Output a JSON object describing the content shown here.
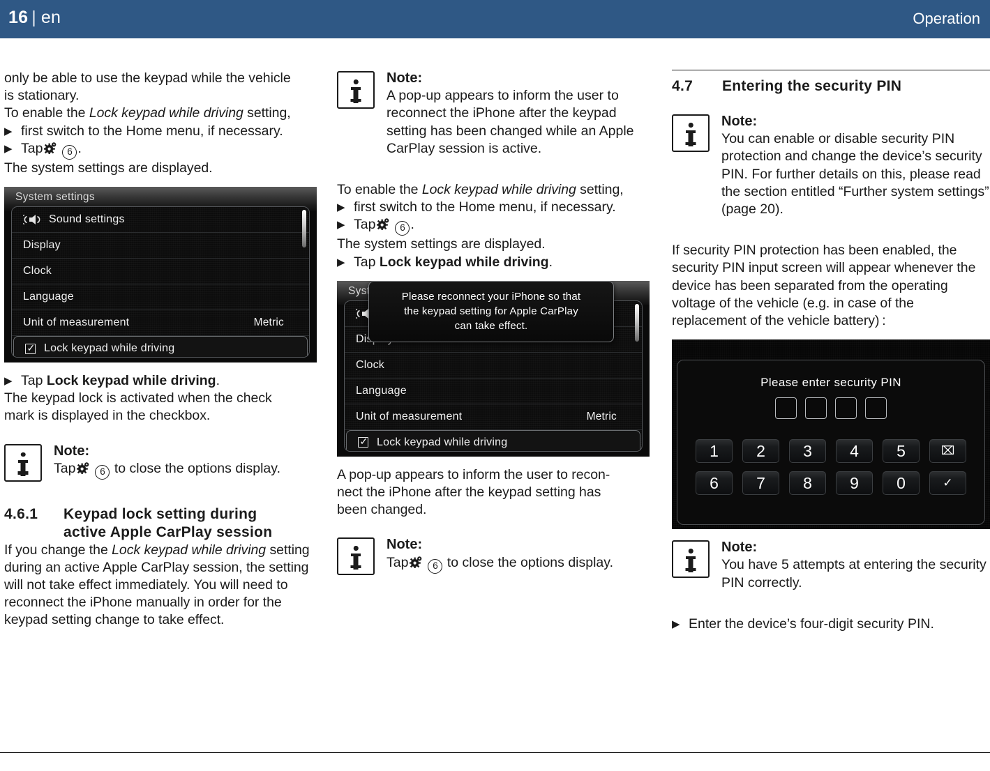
{
  "header": {
    "page_number": "16",
    "separator": "|",
    "language": "en",
    "section": "Operation"
  },
  "column1": {
    "para1_line1": "only be able to use the keypad while the vehicle",
    "para1_line2": "is stationary.",
    "para2_prefix": "To enable the ",
    "para2_italic": "Lock keypad while driving",
    "para2_suffix": " setting,",
    "step1_text": "first switch to the Home menu, if necessary.",
    "step2_prefix": "Tap",
    "step2_callout": "6",
    "step2_suffix": ".",
    "result1": "The system settings are displayed.",
    "screenshot": {
      "title": "System settings",
      "items": [
        {
          "label": "Sound settings",
          "value": "",
          "icon": "speaker-icon",
          "highlight": false
        },
        {
          "label": "Display",
          "value": "",
          "icon": "",
          "highlight": false
        },
        {
          "label": "Clock",
          "value": "",
          "icon": "",
          "highlight": false
        },
        {
          "label": "Language",
          "value": "",
          "icon": "",
          "highlight": false
        },
        {
          "label": "Unit of measurement",
          "value": "Metric",
          "icon": "",
          "highlight": false
        },
        {
          "label": "Lock keypad while driving",
          "value": "",
          "icon": "checkbox-checked-icon",
          "highlight": true
        }
      ]
    },
    "step3_prefix": "Tap ",
    "step3_bold": "Lock keypad while driving",
    "step3_suffix": ".",
    "result2_line1": "The keypad lock is activated when the check",
    "result2_line2": "mark is displayed in the checkbox.",
    "note1": {
      "title": "Note:",
      "text_prefix": "Tap",
      "callout": "6",
      "text_suffix": "to close the options display."
    },
    "heading": {
      "number": "4.6.1",
      "line1": "Keypad lock setting during",
      "line2": "active Apple CarPlay session"
    },
    "para3_prefix": "If you change the ",
    "para3_italic": "Lock keypad while driving",
    "para3_rest": "setting during an active Apple CarPlay session, the setting will not take effect immediately. You will need to reconnect the iPhone manually in order for the keypad setting change to take effect."
  },
  "column2": {
    "note1": {
      "title": "Note:",
      "text": "A pop-up appears to inform the user to reconnect the iPhone after the keypad setting has been changed while an Apple CarPlay session is active."
    },
    "para1_prefix": "To enable the ",
    "para1_italic": "Lock keypad while driving",
    "para1_suffix": " setting,",
    "step1_text": "first switch to the Home menu, if necessary.",
    "step2_prefix": "Tap",
    "step2_callout": "6",
    "step2_suffix": ".",
    "result1": "The system settings are displayed.",
    "step3_prefix": "Tap ",
    "step3_bold": "Lock keypad while driving",
    "step3_suffix": ".",
    "screenshot": {
      "title": "Syst",
      "popup_line1": "Please reconnect your iPhone so that",
      "popup_line2": "the keypad setting for Apple CarPlay",
      "popup_line3": "can take effect.",
      "items": [
        {
          "label": "",
          "value": "",
          "icon": "speaker-icon",
          "highlight": false
        },
        {
          "label": "Display",
          "value": "",
          "icon": "",
          "highlight": false
        },
        {
          "label": "Clock",
          "value": "",
          "icon": "",
          "highlight": false
        },
        {
          "label": "Language",
          "value": "",
          "icon": "",
          "highlight": false
        },
        {
          "label": "Unit of measurement",
          "value": "Metric",
          "icon": "",
          "highlight": false
        },
        {
          "label": "Lock keypad while driving",
          "value": "",
          "icon": "checkbox-checked-icon",
          "highlight": true
        }
      ]
    },
    "result2_line1": "A pop-up appears to inform the user to recon-",
    "result2_line2": "nect the iPhone after the keypad setting has",
    "result2_line3": "been changed.",
    "note2": {
      "title": "Note:",
      "text_prefix": "Tap",
      "callout": "6",
      "text_suffix": "to close the options display."
    }
  },
  "column3": {
    "heading": {
      "number": "4.7",
      "title": "Entering the security PIN"
    },
    "note1": {
      "title": "Note:",
      "text": "You can enable or disable security PIN protection and change the device’s security PIN. For further details on this, please read the section entitled “Further system settings” (page 20)."
    },
    "para1": "If security PIN protection has been enabled, the security PIN input screen will appear whenever the device has been separated from the operating voltage of the vehicle (e.g. in case of the replacement of the vehicle battery) :",
    "pin_screen": {
      "prompt": "Please enter security PIN",
      "digit_count": 4,
      "keys_row1": [
        "1",
        "2",
        "3",
        "4",
        "5",
        "⌧"
      ],
      "keys_row2": [
        "6",
        "7",
        "8",
        "9",
        "0",
        "✓"
      ]
    },
    "note2": {
      "title": "Note:",
      "text": "You have 5 attempts at entering the security PIN correctly."
    },
    "step1_text": "Enter the device’s four-digit security PIN."
  },
  "colors": {
    "header_blue": "#2f5885",
    "text_black": "#1b1b1b",
    "device_black": "#0a0a0a"
  }
}
